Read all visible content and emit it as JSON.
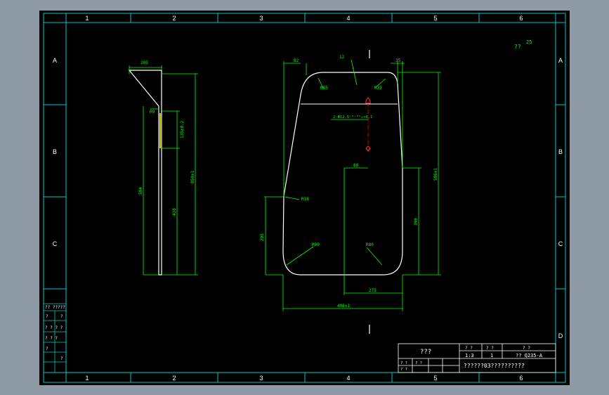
{
  "border": {
    "columns": [
      "1",
      "2",
      "3",
      "4",
      "5",
      "6"
    ],
    "rows": [
      "A",
      "B",
      "C",
      "D"
    ]
  },
  "corner_note": {
    "symbol": "??",
    "value": "25"
  },
  "side_view": {
    "dim_top": "105",
    "dim_radius": "R9",
    "dim_slot": "135±0.2",
    "dim_total": "850±1",
    "dim_left": "584",
    "dim_lower": "438"
  },
  "front_view": {
    "dim_top_left": "82",
    "dim_top_center": "12",
    "dim_top_right": "35",
    "radius_top_left": "R65",
    "radius_top_right": "R33",
    "hole_spec": "2-Φ12.5⁺⁰·⁰⁵₀×0.1",
    "dim_hole_offset": "80",
    "radius_side": "R38",
    "dim_left_height": "295",
    "radius_bottom_left": "R90",
    "radius_bottom_right": "R80",
    "dim_right_inner": "390",
    "dim_right_total": "586±1",
    "dim_bottom_inner": "275",
    "dim_bottom_total": "498±1"
  },
  "left_table": {
    "cells": [
      "??  ?????",
      "?",
      "?",
      "? ? ? ?",
      "? ? ?",
      "?",
      "?"
    ]
  },
  "title_block": {
    "name": "???",
    "header_1": "? ?",
    "header_2": "? ?",
    "header_3": "? ?",
    "scale": "1:3",
    "quantity": "1",
    "material": "?? Q235-A",
    "row_label_1": "? ?",
    "row_label_2": "? ?",
    "row_label_3": "? ?",
    "drawing_title": "??????03??????????"
  }
}
